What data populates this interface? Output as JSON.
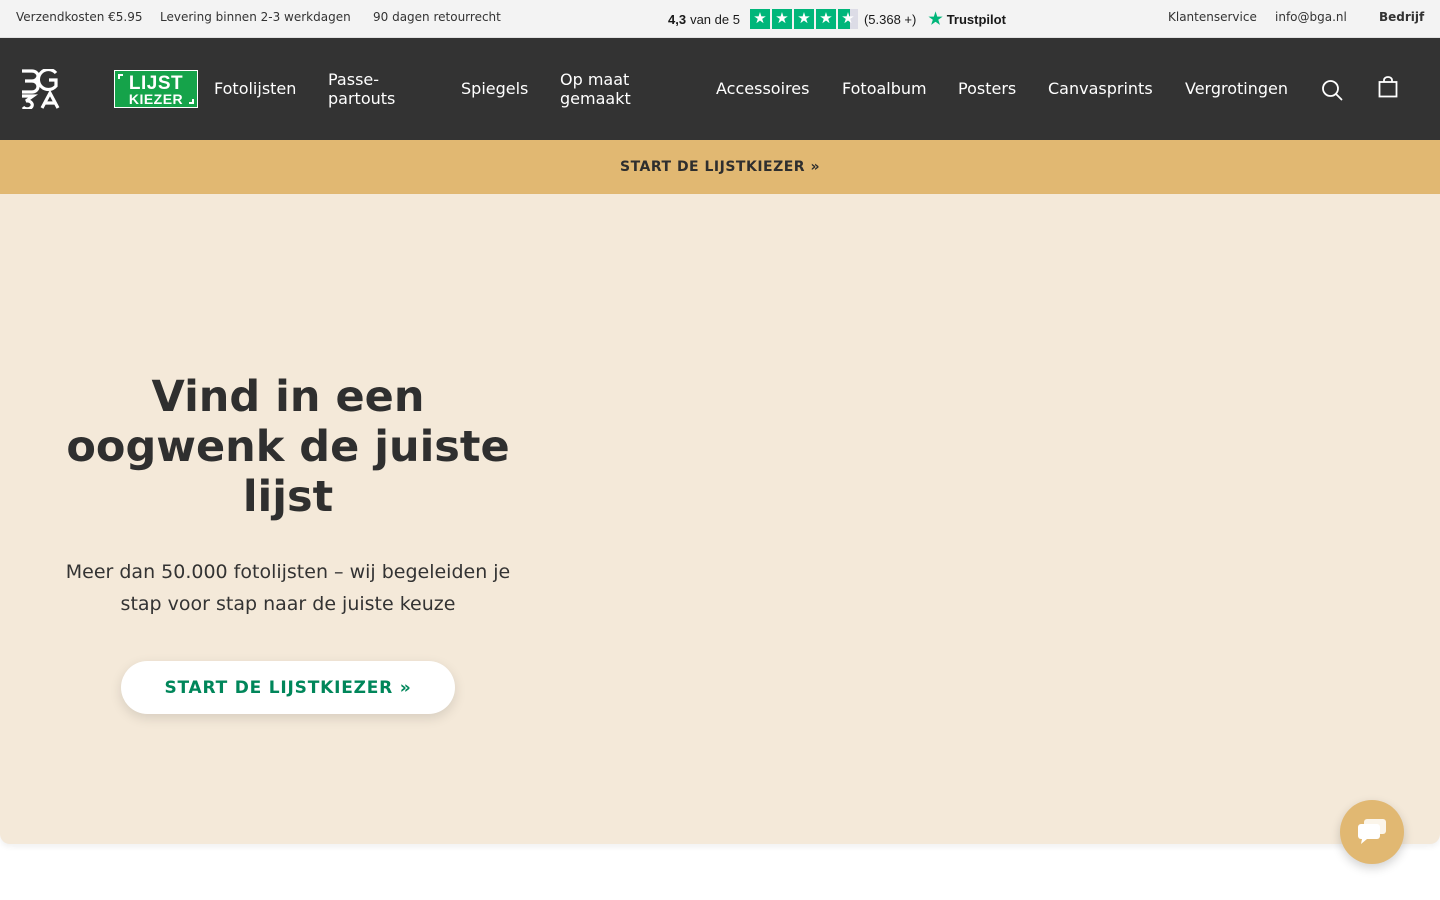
{
  "topbar": {
    "usps": [
      "Verzendkosten €5.95",
      "Levering binnen 2-3 werkdagen",
      "90 dagen retourrecht"
    ],
    "trustpilot": {
      "score": "4,3",
      "score_suffix": "van de 5",
      "stars": 4.3,
      "count": "(5.368 +)",
      "brand": "Trustpilot",
      "star_color": "#00b67a"
    },
    "links": [
      "Klantenservice",
      "info@bga.nl",
      "Bedrijf"
    ]
  },
  "nav": {
    "logo_brand_icon": "bga-logo",
    "lijstkiezer_logo": {
      "line1": "LIJST",
      "line2": "KIEZER",
      "color": "#15a34a"
    },
    "items": [
      {
        "label": "Fotolijsten"
      },
      {
        "label": "Passe-partouts"
      },
      {
        "label": "Spiegels"
      },
      {
        "label": "Op maat gemaakt"
      },
      {
        "label": "Accessoires"
      },
      {
        "label": "Fotoalbum"
      },
      {
        "label": "Posters"
      },
      {
        "label": "Canvasprints"
      },
      {
        "label": "Vergrotingen"
      }
    ],
    "icons": [
      "search-icon",
      "cart-icon"
    ],
    "background": "#333333"
  },
  "announcement": {
    "label": "START DE LIJSTKIEZER »",
    "background": "#e1b872"
  },
  "hero": {
    "title": "Vind in een oogwenk de juiste lijst",
    "subtitle": "Meer dan 50.000 fotolijsten – wij begeleiden je stap voor stap naar de juiste keuze",
    "cta_label": "START DE LIJSTKIEZER »",
    "cta_color": "#00865a",
    "background": "#f4e9d9"
  },
  "chat": {
    "icon": "chat-icon"
  }
}
